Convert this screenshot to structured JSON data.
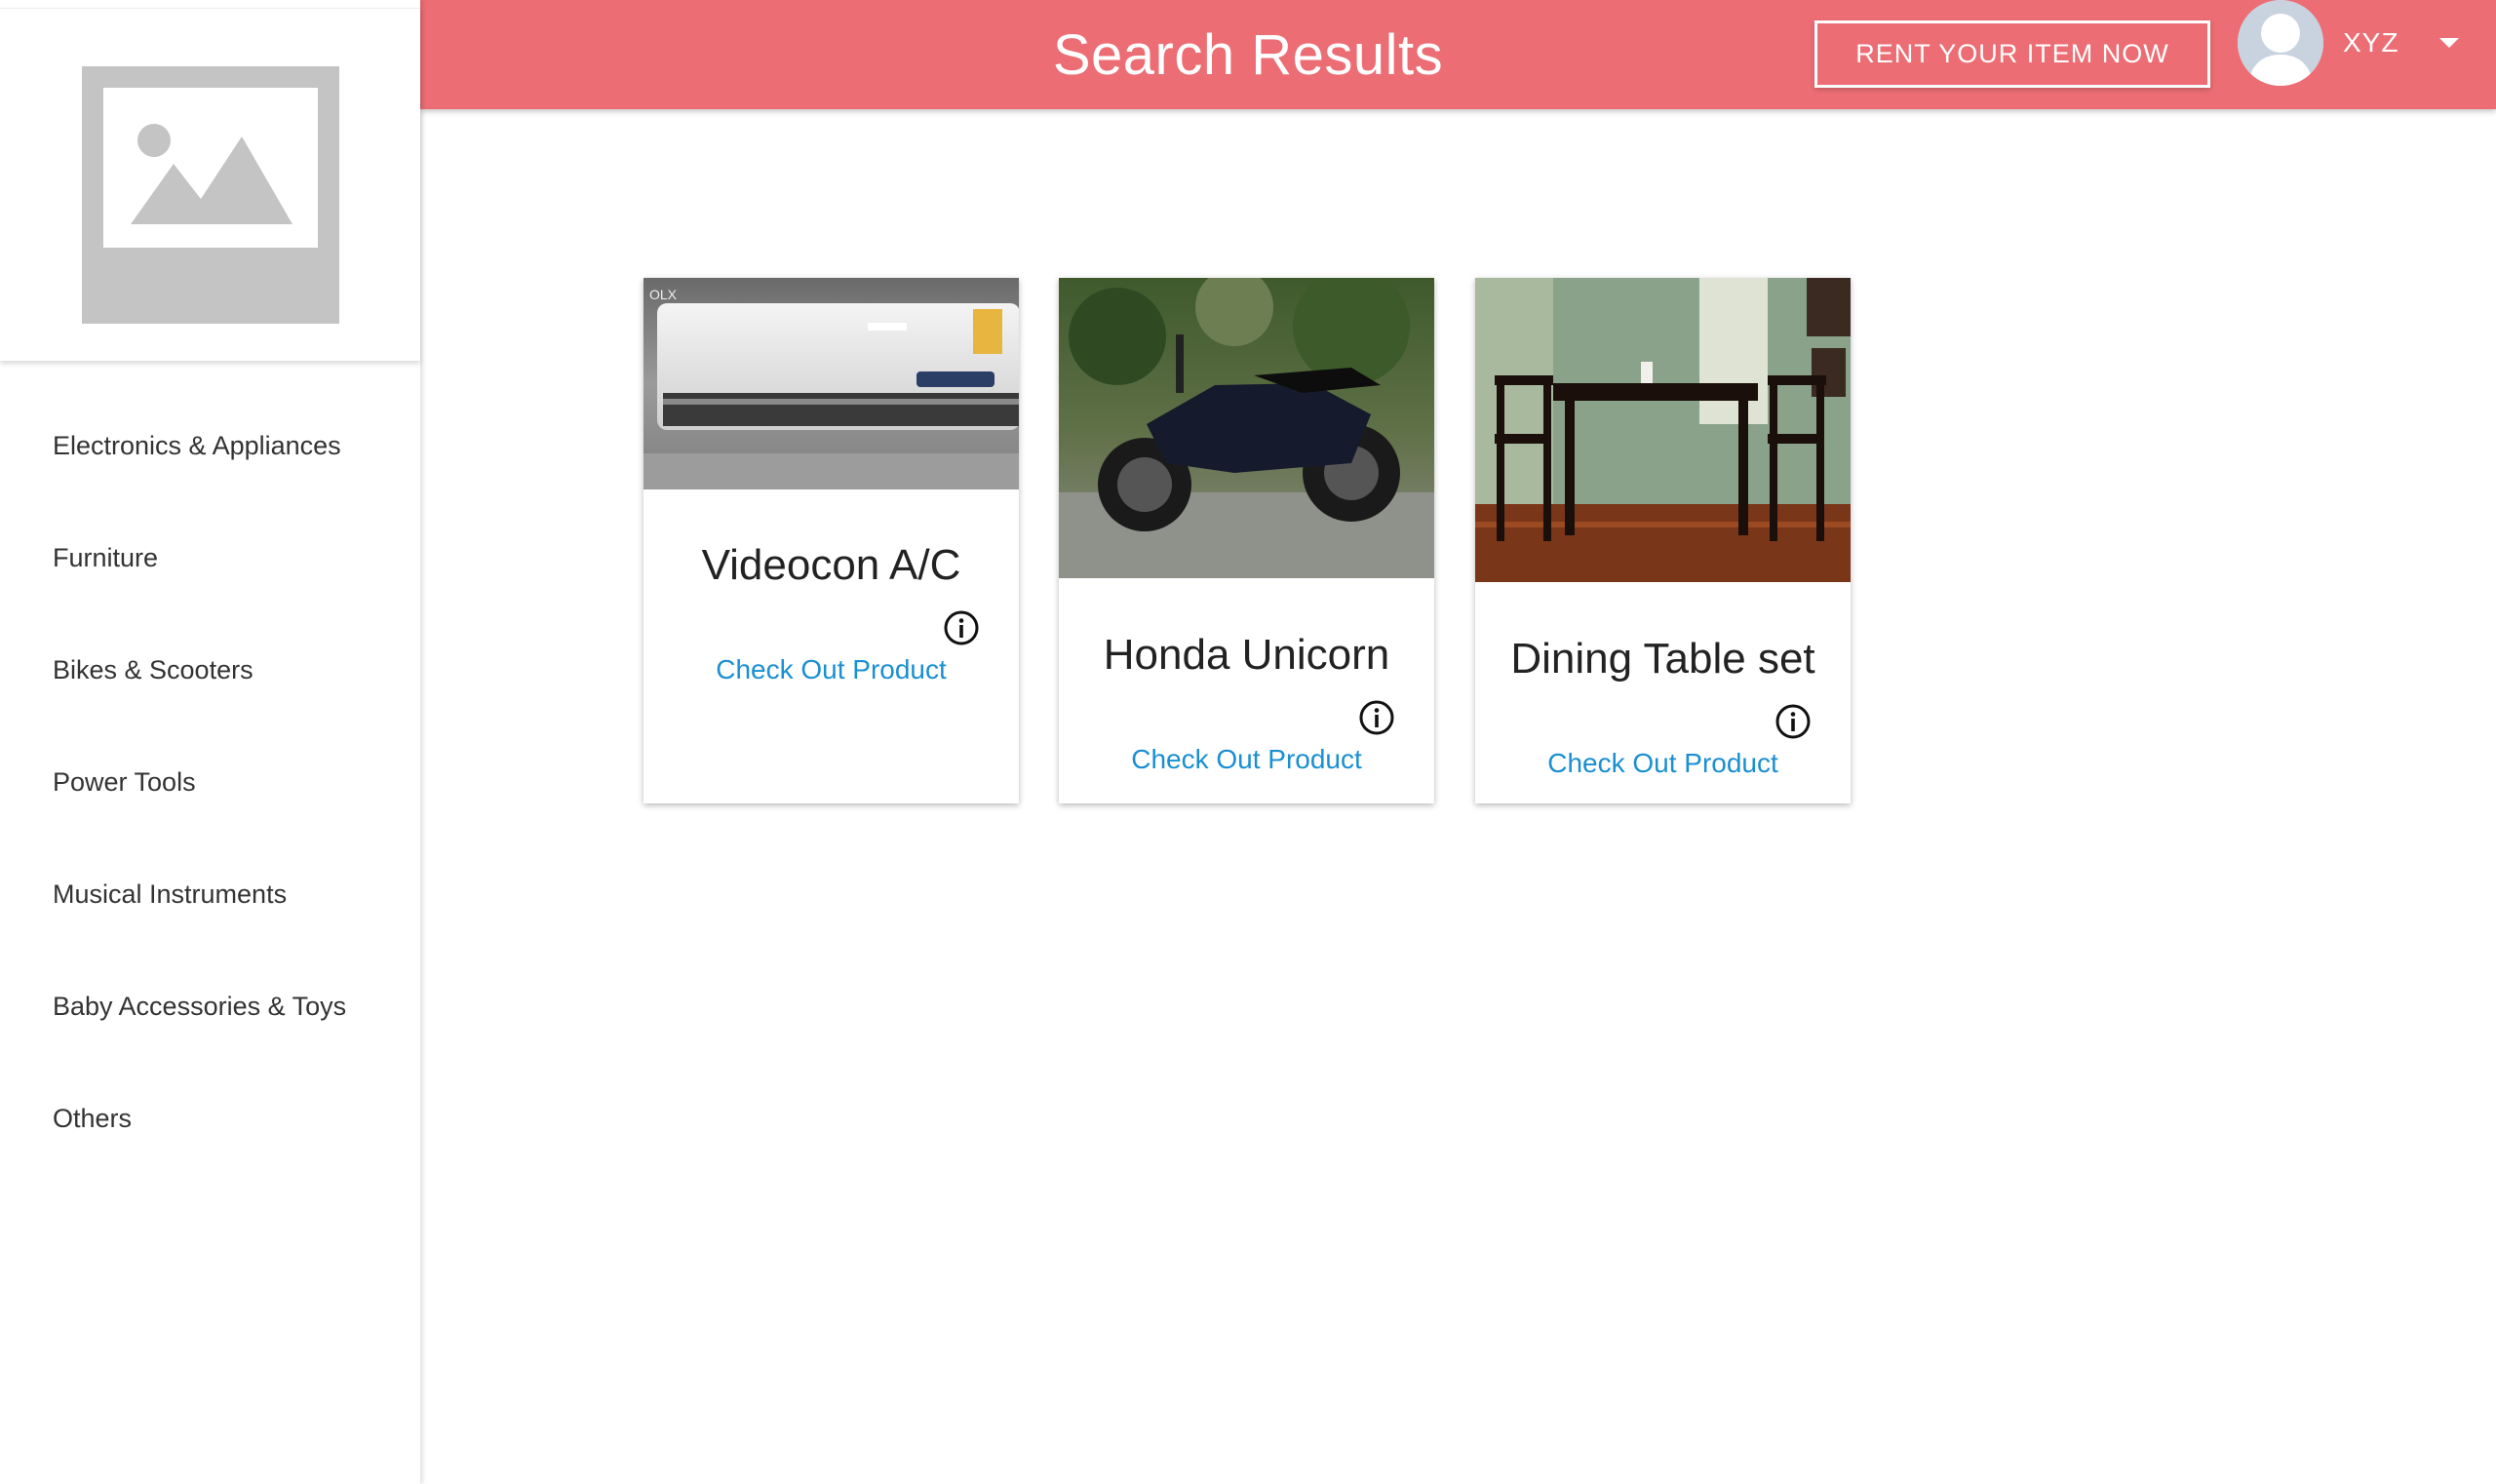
{
  "header": {
    "title": "Search Results",
    "rent_button_label": "RENT YOUR ITEM NOW",
    "username": "XYZ",
    "accent_color": "#ec6e74"
  },
  "sidebar": {
    "logo_icon": "image-placeholder-icon",
    "items": [
      {
        "label": "Electronics & Appliances"
      },
      {
        "label": "Furniture"
      },
      {
        "label": "Bikes & Scooters"
      },
      {
        "label": "Power Tools"
      },
      {
        "label": "Musical Instruments"
      },
      {
        "label": "Baby Accessories & Toys"
      },
      {
        "label": "Others"
      }
    ]
  },
  "results": [
    {
      "title": "Videocon A/C",
      "link_label": "Check Out Product",
      "image": "air-conditioner-photo",
      "info_icon": "info-icon"
    },
    {
      "title": "Honda Unicorn",
      "link_label": "Check Out Product",
      "image": "motorcycle-photo",
      "info_icon": "info-icon"
    },
    {
      "title": "Dining Table set",
      "link_label": "Check Out Product",
      "image": "dining-table-photo",
      "info_icon": "info-icon"
    }
  ]
}
